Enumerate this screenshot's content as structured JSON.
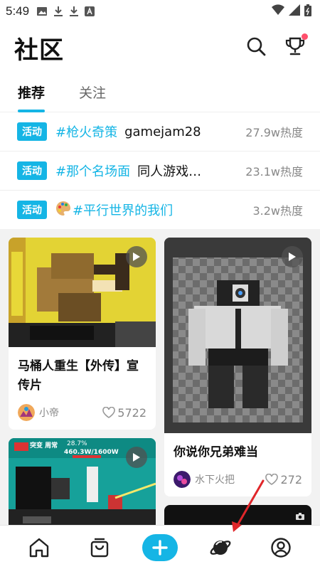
{
  "status_bar": {
    "time": "5:49"
  },
  "header": {
    "title": "社区"
  },
  "tabs": [
    {
      "label": "推荐",
      "active": true
    },
    {
      "label": "关注",
      "active": false
    }
  ],
  "topics": [
    {
      "badge": "活动",
      "tag": "#枪火奇策",
      "desc": "gamejam28",
      "heat": "27.9w热度"
    },
    {
      "badge": "活动",
      "tag": "#那个名场面",
      "desc": "同人游戏…",
      "heat": "23.1w热度"
    },
    {
      "badge": "活动",
      "tag": "#平行世界的我们",
      "desc": "",
      "heat": "3.2w热度"
    }
  ],
  "cards": [
    {
      "title": "马桶人重生【外传】宣传片",
      "author": "小帝",
      "likes": "5722"
    },
    {
      "title": "你说你兄弟难当",
      "author": "水下火把",
      "likes": "272"
    },
    {
      "title": "",
      "author": "",
      "likes": "",
      "overlay_top": "突变 周常",
      "overlay_hp": "28.7%",
      "overlay_hp2": "460.3W/1600W"
    }
  ],
  "colors": {
    "accent": "#15b5e5",
    "dot": "#ff4f6c"
  }
}
